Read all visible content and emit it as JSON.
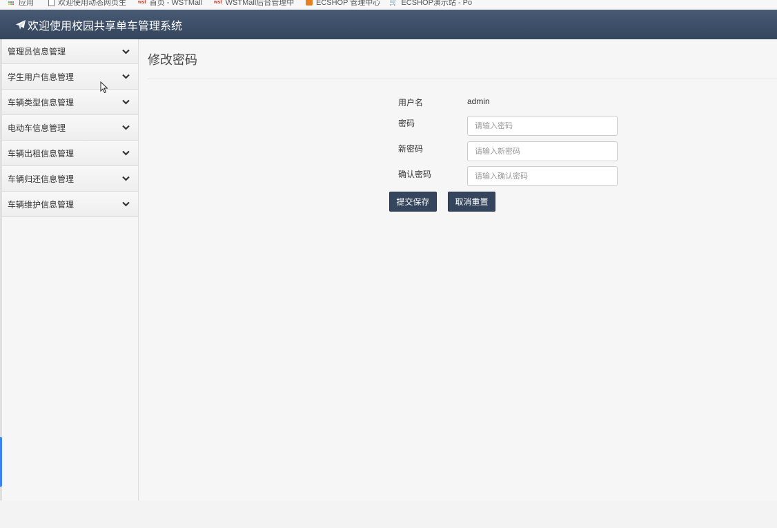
{
  "browser": {
    "bookmarks": [
      {
        "label": "应用",
        "icon": "apps-icon"
      },
      {
        "label": "欢迎使用动态网页生",
        "icon": "page-icon"
      },
      {
        "label": "首页 - WSTMall",
        "icon": "wst-icon"
      },
      {
        "label": "WSTMall后台管理中",
        "icon": "wst-icon"
      },
      {
        "label": "ECSHOP 管理中心",
        "icon": "ecshop-icon"
      },
      {
        "label": "ECSHOP演示站 - Po",
        "icon": "cart-icon"
      }
    ]
  },
  "header": {
    "title": "欢迎使用校园共享单车管理系统",
    "icon": "paper-plane-icon",
    "color": "#3d4f68"
  },
  "sidebar": {
    "items": [
      {
        "label": "管理员信息管理"
      },
      {
        "label": "学生用户信息管理"
      },
      {
        "label": "车辆类型信息管理"
      },
      {
        "label": "电动车信息管理"
      },
      {
        "label": "车辆出租信息管理"
      },
      {
        "label": "车辆归还信息管理"
      },
      {
        "label": "车辆维护信息管理"
      }
    ],
    "expand_icon": "chevron-down-icon"
  },
  "main": {
    "title": "修改密码",
    "form": {
      "username_label": "用户名",
      "username_value": "admin",
      "password_label": "密码",
      "password_placeholder": "请输入密码",
      "new_password_label": "新密码",
      "new_password_placeholder": "请输入新密码",
      "confirm_password_label": "确认密码",
      "confirm_password_placeholder": "请输入确认密码"
    },
    "buttons": {
      "submit_label": "提交保存",
      "reset_label": "取消重置"
    }
  },
  "colors": {
    "header_bg": "#3d4f68",
    "button_bg": "#34455d",
    "page_bg": "#f5f6f5"
  }
}
